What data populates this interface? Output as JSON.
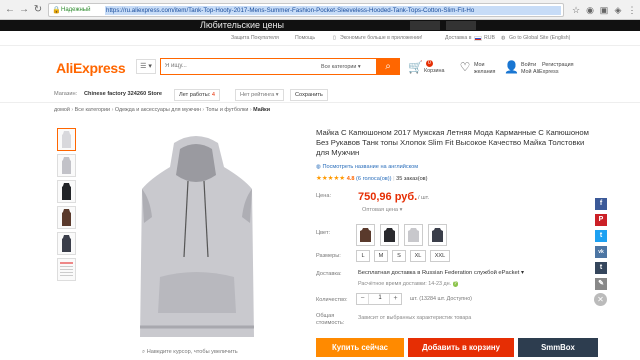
{
  "browser": {
    "secure_label": "Надежный",
    "url": "https://ru.aliexpress.com/item/Tank-Top-Hooty-2017-Mens-Summer-Fashion-Pocket-Sleeveless-Hooded-Tank-Tops-Cotton-Slim-Fit-Ho"
  },
  "banner": {
    "text": "Любительские цены"
  },
  "toplinks": {
    "buyer_protection": "Защита Покупателя",
    "help": "Помощь",
    "app_promo": "Экономьте больше в приложении!",
    "ship_to": "Доставка в",
    "currency": "RUB",
    "global": "Go to Global Site (English)"
  },
  "header": {
    "logo": "AliExpress",
    "search_placeholder": "Я ищу...",
    "search_category": "Все категории",
    "cart_label": "Корзина",
    "cart_count": "0",
    "wishlist_label_1": "Мои",
    "wishlist_label_2": "желания",
    "login": "Войти",
    "register": "Регистрация",
    "my_aliexpress": "Мой AliExpress"
  },
  "store": {
    "shop_label": "Магазин:",
    "shop_name": "Chinese factory 324260 Store",
    "years_label": "Лет работы:",
    "years_value": "4",
    "no_rating": "Нет рейтинга",
    "save": "Сохранить"
  },
  "breadcrumb": {
    "home": "домой",
    "cat1": "Все категории",
    "cat2": "Одежда и аксессуары для мужчин",
    "cat3": "Топы и футболки",
    "current": "Майки"
  },
  "gallery": {
    "zoom_hint": "Наведите курсор, чтобы увеличить",
    "thumb_colors": [
      "#d8d8dc",
      "#c2c2c8",
      "#222428",
      "#5a3a2c",
      "#3a3e4a",
      "#f3e8e8"
    ],
    "main_color": "#c9c9ce"
  },
  "product": {
    "title": "Майка С Капюшоном 2017 Мужская Летняя Мода Карманные С Капюшоном Без Рукавов Танк топы Хлопок Slim Fit Высокое Качество Майка Толстовки для Мужчин",
    "translate_link": "Посмотреть название на английском",
    "rating": "4.8",
    "reviews": "(6 голоса(ов))",
    "orders": "35 заказ(ов)",
    "price_label": "Цена:",
    "price": "750,96 руб.",
    "price_unit": "/ шт.",
    "wholesale": "Оптовая цена",
    "color_label": "Цвет:",
    "swatch_colors": [
      "#5a3a2c",
      "#2a2a2e",
      "#c8c8cc",
      "#3a3e4a"
    ],
    "size_label": "Размеры:",
    "sizes": [
      "L",
      "M",
      "S",
      "XL",
      "XXL"
    ],
    "shipping_label": "Доставка:",
    "shipping_text": "Бесплатная доставка в Russian Federation службой ePacket",
    "shipping_time": "Расчётное время доставки: 14-23 дн.",
    "qty_label": "Количество:",
    "qty_value": "1",
    "qty_info": "шт. (13284 шт. Доступно)",
    "total_label_1": "Общая",
    "total_label_2": "стоимость:",
    "total_value": "Зависит от выбранных характеристик товара",
    "buy_now": "Купить сейчас",
    "add_to_cart": "Добавить в корзину",
    "smmbox": "SmmBox"
  },
  "share": {
    "facebook": "f",
    "pinterest": "P",
    "twitter": "t",
    "vk": "vk",
    "tumblr": "t",
    "edit": "✎",
    "close": "✕"
  },
  "colors": {
    "accent": "#ff6600",
    "price": "#e62e04",
    "buy_now": "#ff8a00",
    "add_to_cart": "#e62e04",
    "smmbox": "#2d3d4f"
  }
}
